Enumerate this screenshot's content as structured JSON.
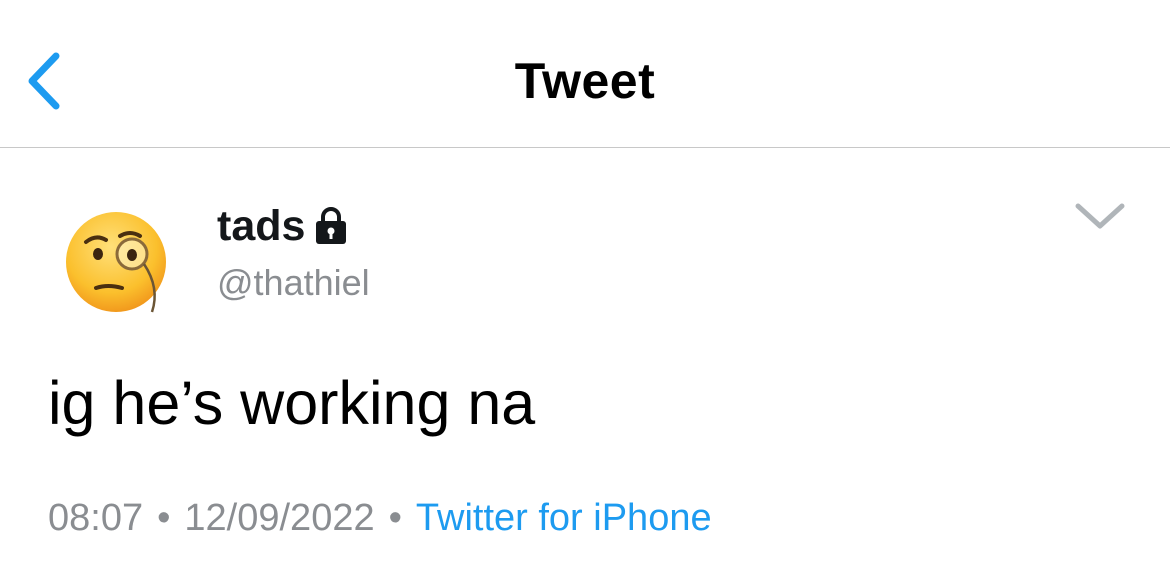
{
  "header": {
    "title": "Tweet",
    "back_icon": "chevron-left-icon",
    "accent_color": "#1d9bf0"
  },
  "tweet": {
    "author": {
      "display_name": "tads",
      "handle": "@thathiel",
      "avatar": "face-with-monocle-emoji",
      "protected_icon": "lock-icon"
    },
    "menu_icon": "chevron-down-icon",
    "text": "ig he’s working na",
    "time": "08:07",
    "separator": "•",
    "date": "12/09/2022",
    "source": "Twitter for iPhone"
  }
}
